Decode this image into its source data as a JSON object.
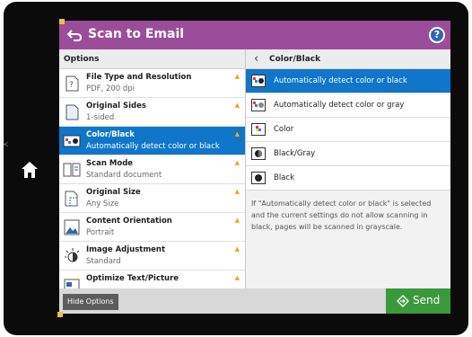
{
  "header": {
    "title": "Scan to Email",
    "help_label": "?"
  },
  "left_panel": {
    "heading": "Options",
    "items": [
      {
        "label": "File Type and Resolution",
        "value": "PDF, 200 dpi",
        "icon": "file-type-icon",
        "selected": false
      },
      {
        "label": "Original Sides",
        "value": "1-sided",
        "icon": "original-sides-icon",
        "selected": false
      },
      {
        "label": "Color/Black",
        "value": "Automatically detect color or black",
        "icon": "color-black-icon",
        "selected": true
      },
      {
        "label": "Scan Mode",
        "value": "Standard document",
        "icon": "scan-mode-icon",
        "selected": false
      },
      {
        "label": "Original Size",
        "value": "Any Size",
        "icon": "original-size-icon",
        "selected": false
      },
      {
        "label": "Content Orientation",
        "value": "Portrait",
        "icon": "orientation-icon",
        "selected": false
      },
      {
        "label": "Image Adjustment",
        "value": "Standard",
        "icon": "image-adjustment-icon",
        "selected": false
      },
      {
        "label": "Optimize Text/Picture",
        "value": "",
        "icon": "optimize-text-icon",
        "selected": false
      }
    ]
  },
  "right_panel": {
    "heading": "Color/Black",
    "choices": [
      {
        "label": "Automatically detect color or black",
        "selected": true
      },
      {
        "label": "Automatically detect color or gray",
        "selected": false
      },
      {
        "label": "Color",
        "selected": false
      },
      {
        "label": "Black/Gray",
        "selected": false
      },
      {
        "label": "Black",
        "selected": false
      }
    ],
    "note": "If \"Automatically detect color or black\" is selected and the current settings do not allow scanning in black, pages will be scanned in grayscale."
  },
  "footer": {
    "hide_label": "Hide Options",
    "send_label": "Send"
  },
  "colors": {
    "title_bar": "#9b4d9a",
    "selection": "#0f76c9",
    "send": "#3a9a3b",
    "warning": "#f2a221"
  }
}
